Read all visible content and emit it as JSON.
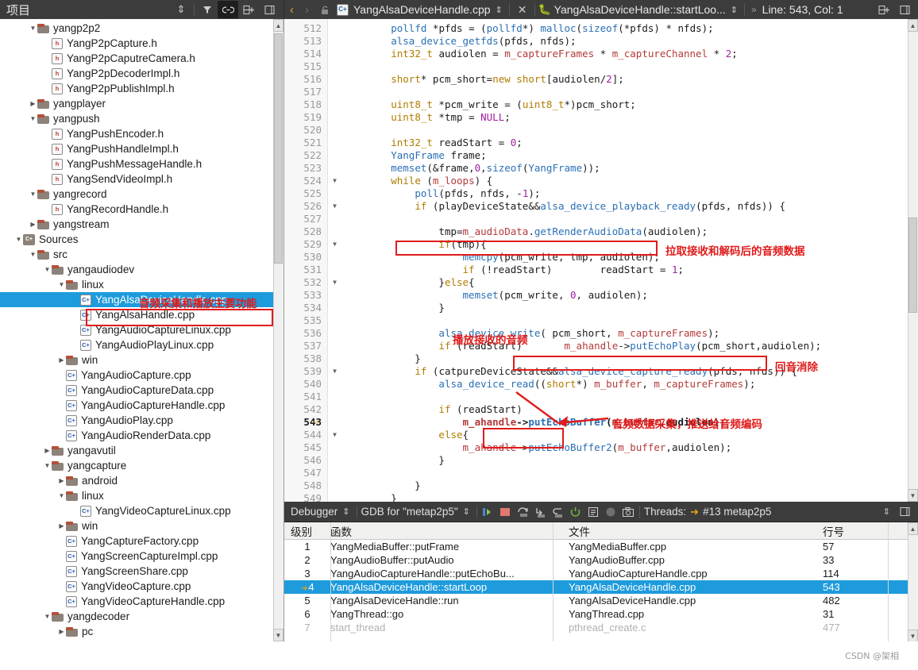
{
  "window": {
    "project_panel_title": "项目",
    "tab_filename": "YangAlsaDeviceHandle.cpp",
    "symbol_selector": "YangAlsaDeviceHandle::startLoo...",
    "line_col": "Line: 543, Col: 1"
  },
  "project_toolbar": {
    "sort_icon": "sort-updown-icon",
    "filter_icon": "filter-icon",
    "link_icon": "link-icon",
    "split_icon": "split-add-icon",
    "close_icon": "panel-close-icon"
  },
  "editor_toolbar": {
    "back_icon": "back-arrow-icon",
    "forward_icon": "forward-arrow-icon",
    "lock_icon": "unlock-icon",
    "file_icon": "cpp-file-icon",
    "dropdown_icon": "updown-chevron-icon",
    "close_icon": "close-icon",
    "symbol_icon": "debug-bug-icon",
    "overflow_icon": "chevron-right-icon",
    "split_icon": "split-add-icon"
  },
  "sidebar": {
    "annotation": "音频采集和播放主要功能",
    "selected_file": "YangAlsaDeviceHandle.cpp",
    "tree": [
      {
        "indent": 2,
        "arrow": "down",
        "type": "folder",
        "label": "yangp2p2"
      },
      {
        "indent": 3,
        "arrow": "none",
        "type": "header",
        "label": "YangP2pCapture.h"
      },
      {
        "indent": 3,
        "arrow": "none",
        "type": "header",
        "label": "YangP2pCaputreCamera.h"
      },
      {
        "indent": 3,
        "arrow": "none",
        "type": "header",
        "label": "YangP2pDecoderImpl.h"
      },
      {
        "indent": 3,
        "arrow": "none",
        "type": "header",
        "label": "YangP2pPublishImpl.h"
      },
      {
        "indent": 2,
        "arrow": "right",
        "type": "folder",
        "label": "yangplayer"
      },
      {
        "indent": 2,
        "arrow": "down",
        "type": "folder",
        "label": "yangpush"
      },
      {
        "indent": 3,
        "arrow": "none",
        "type": "header",
        "label": "YangPushEncoder.h"
      },
      {
        "indent": 3,
        "arrow": "none",
        "type": "header",
        "label": "YangPushHandleImpl.h"
      },
      {
        "indent": 3,
        "arrow": "none",
        "type": "header",
        "label": "YangPushMessageHandle.h"
      },
      {
        "indent": 3,
        "arrow": "none",
        "type": "header",
        "label": "YangSendVideoImpl.h"
      },
      {
        "indent": 2,
        "arrow": "down",
        "type": "folder",
        "label": "yangrecord"
      },
      {
        "indent": 3,
        "arrow": "none",
        "type": "header",
        "label": "YangRecordHandle.h"
      },
      {
        "indent": 2,
        "arrow": "right",
        "type": "folder",
        "label": "yangstream"
      },
      {
        "indent": 1,
        "arrow": "down",
        "type": "sources",
        "label": "Sources"
      },
      {
        "indent": 2,
        "arrow": "down",
        "type": "folder",
        "label": "src"
      },
      {
        "indent": 3,
        "arrow": "down",
        "type": "folder",
        "label": "yangaudiodev"
      },
      {
        "indent": 4,
        "arrow": "down",
        "type": "folder",
        "label": "linux"
      },
      {
        "indent": 5,
        "arrow": "none",
        "type": "cpp",
        "label": "YangAlsaDeviceHandle.cpp",
        "selected": true
      },
      {
        "indent": 5,
        "arrow": "none",
        "type": "cpp",
        "label": "YangAlsaHandle.cpp"
      },
      {
        "indent": 5,
        "arrow": "none",
        "type": "cpp",
        "label": "YangAudioCaptureLinux.cpp"
      },
      {
        "indent": 5,
        "arrow": "none",
        "type": "cpp",
        "label": "YangAudioPlayLinux.cpp"
      },
      {
        "indent": 4,
        "arrow": "right",
        "type": "folder",
        "label": "win"
      },
      {
        "indent": 4,
        "arrow": "none",
        "type": "cpp",
        "label": "YangAudioCapture.cpp"
      },
      {
        "indent": 4,
        "arrow": "none",
        "type": "cpp",
        "label": "YangAudioCaptureData.cpp"
      },
      {
        "indent": 4,
        "arrow": "none",
        "type": "cpp",
        "label": "YangAudioCaptureHandle.cpp"
      },
      {
        "indent": 4,
        "arrow": "none",
        "type": "cpp",
        "label": "YangAudioPlay.cpp"
      },
      {
        "indent": 4,
        "arrow": "none",
        "type": "cpp",
        "label": "YangAudioRenderData.cpp"
      },
      {
        "indent": 3,
        "arrow": "right",
        "type": "folder",
        "label": "yangavutil"
      },
      {
        "indent": 3,
        "arrow": "down",
        "type": "folder",
        "label": "yangcapture"
      },
      {
        "indent": 4,
        "arrow": "right",
        "type": "folder",
        "label": "android"
      },
      {
        "indent": 4,
        "arrow": "down",
        "type": "folder",
        "label": "linux"
      },
      {
        "indent": 5,
        "arrow": "none",
        "type": "cpp",
        "label": "YangVideoCaptureLinux.cpp"
      },
      {
        "indent": 4,
        "arrow": "right",
        "type": "folder",
        "label": "win"
      },
      {
        "indent": 4,
        "arrow": "none",
        "type": "cpp",
        "label": "YangCaptureFactory.cpp"
      },
      {
        "indent": 4,
        "arrow": "none",
        "type": "cpp",
        "label": "YangScreenCaptureImpl.cpp"
      },
      {
        "indent": 4,
        "arrow": "none",
        "type": "cpp",
        "label": "YangScreenShare.cpp"
      },
      {
        "indent": 4,
        "arrow": "none",
        "type": "cpp",
        "label": "YangVideoCapture.cpp"
      },
      {
        "indent": 4,
        "arrow": "none",
        "type": "cpp",
        "label": "YangVideoCaptureHandle.cpp"
      },
      {
        "indent": 3,
        "arrow": "down",
        "type": "folder",
        "label": "yangdecoder"
      },
      {
        "indent": 4,
        "arrow": "right",
        "type": "folder",
        "label": "pc"
      }
    ]
  },
  "editor": {
    "current_line": 543,
    "lines": [
      {
        "n": 512,
        "fold": "",
        "text": "        pollfd *pfds = (pollfd*) malloc(sizeof(*pfds) * nfds);"
      },
      {
        "n": 513,
        "fold": "",
        "text": "        alsa_device_getfds(pfds, nfds);"
      },
      {
        "n": 514,
        "fold": "",
        "text": "        int32_t audiolen = m_captureFrames * m_captureChannel * 2;"
      },
      {
        "n": 515,
        "fold": "",
        "text": ""
      },
      {
        "n": 516,
        "fold": "",
        "text": "        short* pcm_short=new short[audiolen/2];"
      },
      {
        "n": 517,
        "fold": "",
        "text": ""
      },
      {
        "n": 518,
        "fold": "",
        "text": "        uint8_t *pcm_write = (uint8_t*)pcm_short;"
      },
      {
        "n": 519,
        "fold": "",
        "text": "        uint8_t *tmp = NULL;"
      },
      {
        "n": 520,
        "fold": "",
        "text": ""
      },
      {
        "n": 521,
        "fold": "",
        "text": "        int32_t readStart = 0;"
      },
      {
        "n": 522,
        "fold": "",
        "text": "        YangFrame frame;"
      },
      {
        "n": 523,
        "fold": "",
        "text": "        memset(&frame,0,sizeof(YangFrame));"
      },
      {
        "n": 524,
        "fold": "▼",
        "text": "        while (m_loops) {"
      },
      {
        "n": 525,
        "fold": "",
        "text": "            poll(pfds, nfds, -1);"
      },
      {
        "n": 526,
        "fold": "▼",
        "text": "            if (playDeviceState&&alsa_device_playback_ready(pfds, nfds)) {"
      },
      {
        "n": 527,
        "fold": "",
        "text": ""
      },
      {
        "n": 528,
        "fold": "",
        "text": "                tmp=m_audioData.getRenderAudioData(audiolen);"
      },
      {
        "n": 529,
        "fold": "▼",
        "text": "                if(tmp){"
      },
      {
        "n": 530,
        "fold": "",
        "text": "                    memcpy(pcm_write, tmp, audiolen);"
      },
      {
        "n": 531,
        "fold": "",
        "text": "                    if (!readStart)        readStart = 1;"
      },
      {
        "n": 532,
        "fold": "▼",
        "text": "                }else{"
      },
      {
        "n": 533,
        "fold": "",
        "text": "                    memset(pcm_write, 0, audiolen);"
      },
      {
        "n": 534,
        "fold": "",
        "text": "                }"
      },
      {
        "n": 535,
        "fold": "",
        "text": ""
      },
      {
        "n": 536,
        "fold": "",
        "text": "                alsa_device_write( pcm_short, m_captureFrames);"
      },
      {
        "n": 537,
        "fold": "",
        "text": "                if (readStart)       m_ahandle->putEchoPlay(pcm_short,audiolen);"
      },
      {
        "n": 538,
        "fold": "",
        "text": "            }"
      },
      {
        "n": 539,
        "fold": "▼",
        "text": "            if (catpureDeviceState&&alsa_device_capture_ready(pfds, nfds)) {"
      },
      {
        "n": 540,
        "fold": "",
        "text": "                alsa_device_read((short*) m_buffer, m_captureFrames);"
      },
      {
        "n": 541,
        "fold": "",
        "text": ""
      },
      {
        "n": 542,
        "fold": "",
        "text": "                if (readStart)"
      },
      {
        "n": 543,
        "fold": "",
        "text": "                    m_ahandle->putEchoBuffer(m_buffer,audiolen);"
      },
      {
        "n": 544,
        "fold": "▼",
        "text": "                else{"
      },
      {
        "n": 545,
        "fold": "",
        "text": "                    m_ahandle->putEchoBuffer2(m_buffer,audiolen);"
      },
      {
        "n": 546,
        "fold": "",
        "text": "                }"
      },
      {
        "n": 547,
        "fold": "",
        "text": ""
      },
      {
        "n": 548,
        "fold": "",
        "text": "            }"
      },
      {
        "n": 549,
        "fold": "",
        "text": "        }"
      }
    ],
    "annotations": [
      {
        "id": "pull-decode",
        "text": "拉取接收和解码后的音频数据"
      },
      {
        "id": "play-received",
        "text": "播放接收的音频"
      },
      {
        "id": "echo-cancel",
        "text": "回音消除"
      },
      {
        "id": "capture-push",
        "text": "音频数据采集，推送给音频编码"
      }
    ]
  },
  "debugger": {
    "label": "Debugger",
    "engine": "GDB for \"metap2p5\"",
    "threads_label": "Threads:",
    "thread_value": "#13 metap2p5",
    "icons": [
      "step-into-icon",
      "step-out-icon",
      "step-over-line-icon",
      "step-into-line-icon",
      "step-return-icon",
      "restart-icon",
      "console-icon",
      "record-icon",
      "screenshot-icon"
    ],
    "columns": [
      "级别",
      "函数",
      "文件",
      "行号"
    ],
    "rows": [
      {
        "level": "1",
        "fn": "YangMediaBuffer::putFrame",
        "file": "YangMediaBuffer.cpp",
        "line": "57",
        "state": "normal"
      },
      {
        "level": "2",
        "fn": "YangAudioBuffer::putAudio",
        "file": "YangAudioBuffer.cpp",
        "line": "33",
        "state": "normal"
      },
      {
        "level": "3",
        "fn": "YangAudioCaptureHandle::putEchoBu...",
        "file": "YangAudioCaptureHandle.cpp",
        "line": "114",
        "state": "normal"
      },
      {
        "level": "4",
        "fn": "YangAlsaDeviceHandle::startLoop",
        "file": "YangAlsaDeviceHandle.cpp",
        "line": "543",
        "state": "selected"
      },
      {
        "level": "5",
        "fn": "YangAlsaDeviceHandle::run",
        "file": "YangAlsaDeviceHandle.cpp",
        "line": "482",
        "state": "normal"
      },
      {
        "level": "6",
        "fn": "YangThread::go",
        "file": "YangThread.cpp",
        "line": "31",
        "state": "normal"
      },
      {
        "level": "7",
        "fn": "start_thread",
        "file": "pthread_create.c",
        "line": "477",
        "state": "dim"
      }
    ]
  },
  "watermark": "CSDN @架相",
  "colors": {
    "accent": "#1e9bdc",
    "annotation_red": "#e01b1b",
    "chrome_dark": "#3c3c3c"
  }
}
